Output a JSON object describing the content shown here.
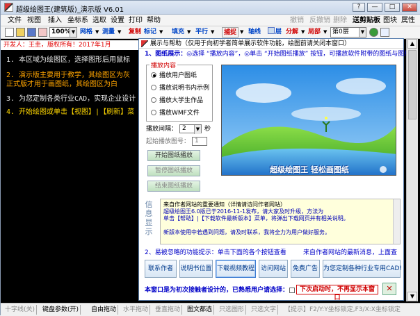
{
  "window": {
    "title": "超级绘图王(建筑版)_演示版 V6.01",
    "controls": [
      "?",
      "—",
      "□",
      "✕"
    ]
  },
  "menu": {
    "left": [
      "文件",
      "视图",
      "插入",
      "坐标系",
      "选取",
      "设置",
      "打印",
      "帮助"
    ],
    "right_dim": [
      "撤销",
      "反撤销",
      "删除"
    ],
    "right": [
      "送剪贴板",
      "图块",
      "属性"
    ]
  },
  "toolbar": {
    "zoom": "100%",
    "grid": "网格",
    "measure": "测量",
    "copy": "复制",
    "mark": "标记",
    "fill": "填充",
    "parallel": "平行",
    "snap": "捕捉",
    "axis": "轴线",
    "layer_icon": "层",
    "split": "分解",
    "local": "局部",
    "layer_select": "第0层"
  },
  "canvas": {
    "author": "开发人：王圭，版权所有！2017年1月",
    "lines": [
      {
        "text": "1. 本区域为绘图区，选择图形后用鼠标",
        "color": "#e8e8e8"
      },
      {
        "text": "2. 演示版主要用于教学，其绘图区为灰",
        "color": "#ffa500"
      },
      {
        "text": "   正式版才用于画图纸，其绘图区为白",
        "color": "#ffa500"
      },
      {
        "text": "3. 为您定制各类行业CAD，实现企业设计",
        "color": "#e8e8e8"
      },
      {
        "text": "4. 开始绘图或单击【视图】|【刷新】菜",
        "color": "#ffd700"
      }
    ]
  },
  "dialog": {
    "title": "展示与帮助（仅用于向初学者简单展示软件功能，绘图前请关闭本窗口）",
    "sec1_head": "1、图纸展示：",
    "sec1_text": "◎选择 “播放内容”，◎单击 “开始图纸播放” 按钮，可播放软件附带的图纸与图形",
    "group_title": "播放内容",
    "options": [
      {
        "label": "播放用户图纸",
        "selected": true
      },
      {
        "label": "播放说明书内示例",
        "selected": false
      },
      {
        "label": "播放大学生作品",
        "selected": false
      },
      {
        "label": "播放WMF文件",
        "selected": false
      }
    ],
    "interval_label": "播放间隔：",
    "interval_value": "2",
    "interval_unit": "秒",
    "start_page_label": "起始播放图号：",
    "start_page_value": "1",
    "btn_start": "开始图纸播放",
    "btn_pause": "暂停图纸播放",
    "btn_end": "结束图纸播放",
    "preview_caption": "超级绘图王    轻松画图纸",
    "info_side": "信息显示",
    "info_lines": [
      "来自作者网站的重要通知（详情请访问作者网站）",
      "    超级绘图王6.0版已于2016-11-1发布，请大家及时升级，方法为",
      "    单击【帮助】|【下载软件最新版本】菜单，将弹出下载网页并有相关说明。",
      "",
      "    新版本使用中若遇到问题，请及时联系，我将全力为用户做好服务。"
    ],
    "sec2_text": "2、易被忽略的功能提示：单击下面的各个按钮查看",
    "sec2_right": "来自作者网站的最新消息，上面查",
    "buttons": [
      "联系作者",
      "说明书位置",
      "下载视频教程",
      "访问网站",
      "免费广告",
      "为您定制各种行业专用CAD!"
    ],
    "bottom_text": "本窗口是为初次接触者设计的，已熟悉用户请选择：",
    "hide_label": "下次启动时，不再显示本窗口",
    "close_label": "✕"
  },
  "status": {
    "items": [
      {
        "text": "十字线(关)",
        "dim": true
      },
      {
        "text": "键盘参数(开)",
        "dim": false
      },
      {
        "text": "自由拖动",
        "dim": false
      },
      {
        "text": "水平拖动",
        "dim": true
      },
      {
        "text": "垂直拖动",
        "dim": true
      },
      {
        "text": "图文都选",
        "dim": false
      },
      {
        "text": "只选图形",
        "dim": true
      },
      {
        "text": "只选文字",
        "dim": true
      },
      {
        "text": "【提示】F2/Y:Y坐标锁定,F3/X:X坐标锁定",
        "dim": true
      }
    ]
  },
  "colors": {
    "title_gradient": "#c9d7ea",
    "canvas_bg": "#000000",
    "accent_blue": "#0000c8",
    "accent_red": "#d00000"
  }
}
